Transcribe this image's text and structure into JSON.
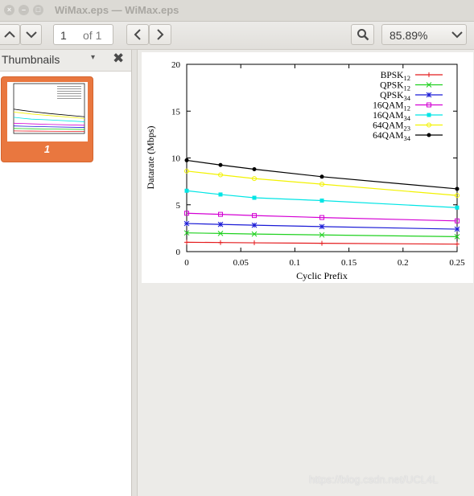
{
  "window": {
    "title": "WiMax.eps — WiMax.eps",
    "close_glyph": "×",
    "minimize_glyph": "–",
    "maximize_glyph": "□"
  },
  "toolbar": {
    "page_current": "1",
    "page_total": "of 1",
    "zoom": "85.89%",
    "icons": [
      "chevron-up-icon",
      "chevron-down-icon",
      "chevron-left-icon",
      "chevron-right-icon",
      "search-icon",
      "dropdown-arrow-icon"
    ]
  },
  "sidebar": {
    "title": "Thumbnails",
    "caret": "▾",
    "close": "✖",
    "thumbnails": [
      {
        "label": "1"
      }
    ]
  },
  "watermark": "https://blog.csdn.net/UCL4L",
  "chart_data": {
    "type": "line",
    "title": "",
    "xlabel": "Cyclic Prefix",
    "ylabel": "Datarate (Mbps)",
    "xlim": [
      0,
      0.25
    ],
    "ylim": [
      0,
      20
    ],
    "xticks": [
      "0",
      "0.05",
      "0.1",
      "0.15",
      "0.2",
      "0.25"
    ],
    "yticks": [
      "0",
      "5",
      "10",
      "15",
      "20"
    ],
    "legend_position": "top-right",
    "x": [
      0,
      0.03125,
      0.0625,
      0.125,
      0.25
    ],
    "series": [
      {
        "name": "BPSK",
        "sub": "12",
        "color": "#e41a1c",
        "marker": "plus",
        "values": [
          1.0,
          0.97,
          0.94,
          0.89,
          0.8
        ]
      },
      {
        "name": "QPSK",
        "sub": "12",
        "color": "#1fd11f",
        "marker": "x",
        "values": [
          2.0,
          1.94,
          1.88,
          1.78,
          1.6
        ]
      },
      {
        "name": "QPSK",
        "sub": "34",
        "color": "#1a1ad6",
        "marker": "star",
        "values": [
          3.0,
          2.91,
          2.82,
          2.67,
          2.4
        ]
      },
      {
        "name": "16QAM",
        "sub": "12",
        "color": "#d400d4",
        "marker": "square",
        "values": [
          4.1,
          3.98,
          3.85,
          3.64,
          3.28
        ]
      },
      {
        "name": "16QAM",
        "sub": "34",
        "color": "#00e5e5",
        "marker": "filled-square",
        "values": [
          6.5,
          6.1,
          5.75,
          5.45,
          4.7
        ]
      },
      {
        "name": "64QAM",
        "sub": "23",
        "color": "#f2f200",
        "marker": "circle",
        "values": [
          8.6,
          8.2,
          7.8,
          7.2,
          6.0
        ]
      },
      {
        "name": "64QAM",
        "sub": "34",
        "color": "#000000",
        "marker": "filled-circle",
        "values": [
          9.75,
          9.25,
          8.8,
          8.0,
          6.7
        ]
      }
    ]
  }
}
